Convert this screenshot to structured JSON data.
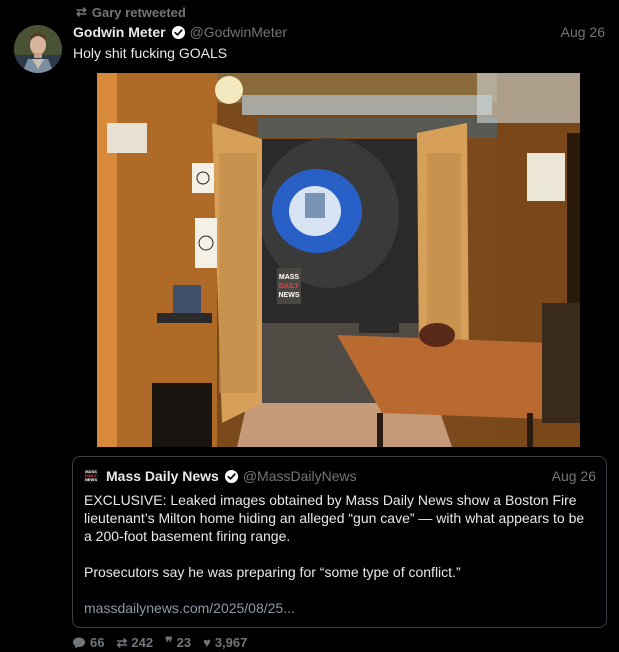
{
  "retweet": {
    "label": "Gary retweeted"
  },
  "tweet": {
    "display_name": "Godwin Meter",
    "handle": "@GodwinMeter",
    "date": "Aug 26",
    "text": "Holy shit fucking GOALS"
  },
  "photo": {
    "watermark_lines": [
      "MASS",
      "DAILY",
      "NEWS"
    ]
  },
  "quote": {
    "display_name": "Mass Daily News",
    "handle": "@MassDailyNews",
    "date": "Aug 26",
    "paragraph1": "EXCLUSIVE: Leaked images obtained by Mass Daily News show a Boston Fire lieutenant’s Milton home hiding an alleged “gun cave” — with what appears to be a 200-foot basement firing range.",
    "paragraph2": "Prosecutors say he was preparing for “some type of conflict.”",
    "link": "massdailynews.com/2025/08/25..."
  },
  "actions": {
    "replies": "66",
    "retweets": "242",
    "quotes": "23",
    "likes": "3,967"
  },
  "colors": {
    "background": "#000000",
    "text": "#e7e9ea",
    "muted": "#71767b",
    "verified": "#1d9bf0"
  }
}
